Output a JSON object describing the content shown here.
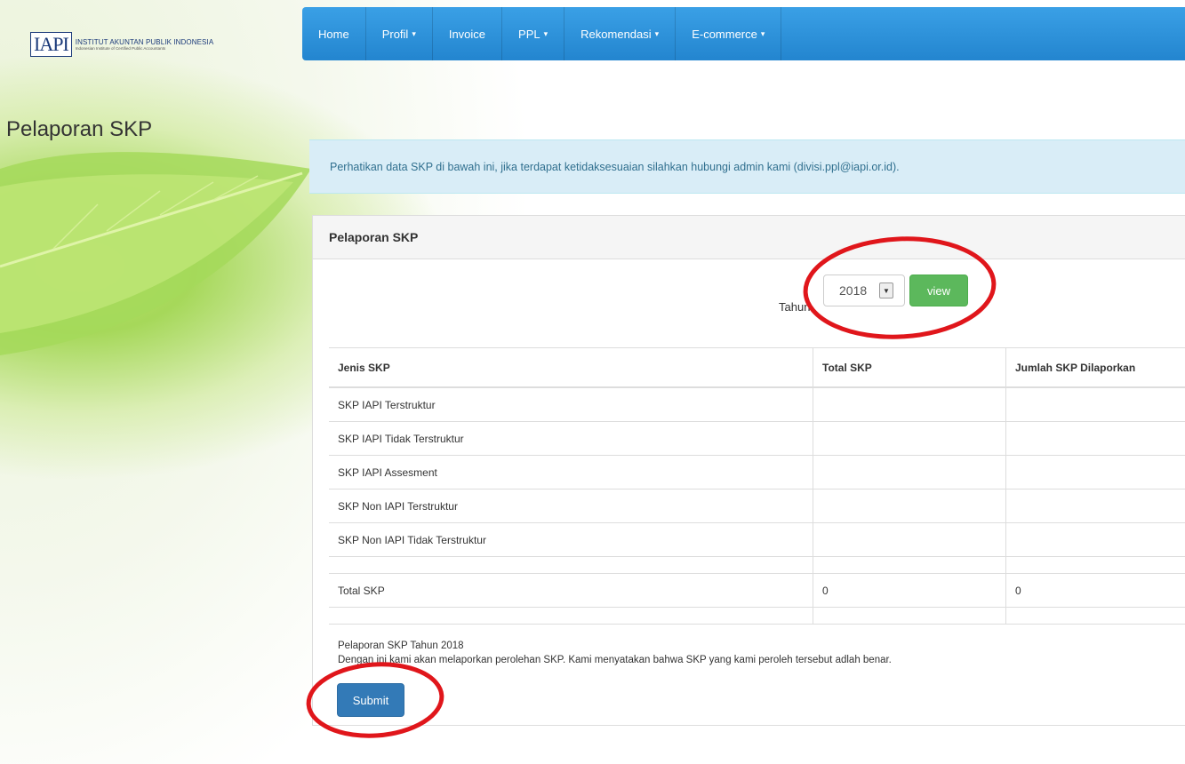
{
  "logo": {
    "mark": "IAPI",
    "line1": "INSTITUT AKUNTAN PUBLIK INDONESIA",
    "line2": "Indonesian Institute of Certified Public Accountants"
  },
  "navbar": {
    "items": [
      {
        "label": "Home",
        "caret": ""
      },
      {
        "label": "Profil",
        "caret": "▾"
      },
      {
        "label": "Invoice",
        "caret": ""
      },
      {
        "label": "PPL",
        "caret": "▾"
      },
      {
        "label": "Rekomendasi",
        "caret": "▾"
      },
      {
        "label": "E-commerce",
        "caret": "▾"
      }
    ]
  },
  "page_title": "Pelaporan SKP",
  "alert_text": "Perhatikan data SKP di bawah ini, jika terdapat ketidaksesuaian silahkan hubungi admin kami (divisi.ppl@iapi.or.id).",
  "panel": {
    "heading": "Pelaporan SKP",
    "year_label": "Tahun",
    "year_value": "2018",
    "view_label": "view",
    "table": {
      "headers": [
        "Jenis SKP",
        "Total SKP",
        "Jumlah SKP Dilaporkan"
      ],
      "rows": [
        [
          "SKP IAPI Terstruktur",
          "",
          ""
        ],
        [
          "SKP IAPI Tidak Terstruktur",
          "",
          ""
        ],
        [
          "SKP IAPI Assesment",
          "",
          ""
        ],
        [
          "SKP Non IAPI Terstruktur",
          "",
          ""
        ],
        [
          "SKP Non IAPI Tidak Terstruktur",
          "",
          ""
        ],
        [
          "",
          "",
          ""
        ],
        [
          "Total SKP",
          "0",
          "0"
        ],
        [
          "",
          "",
          ""
        ]
      ]
    },
    "footer_line1": "Pelaporan SKP Tahun 2018",
    "footer_line2": "Dengan ini kami akan melaporkan perolehan SKP. Kami menyatakan bahwa SKP yang kami peroleh tersebut adlah benar.",
    "submit_label": "Submit"
  },
  "colors": {
    "navbar": "#2a8fd9",
    "alert_bg": "#d9edf7",
    "view_button": "#5cb85c",
    "submit_button": "#337ab7",
    "annotation": "#e0161b"
  }
}
